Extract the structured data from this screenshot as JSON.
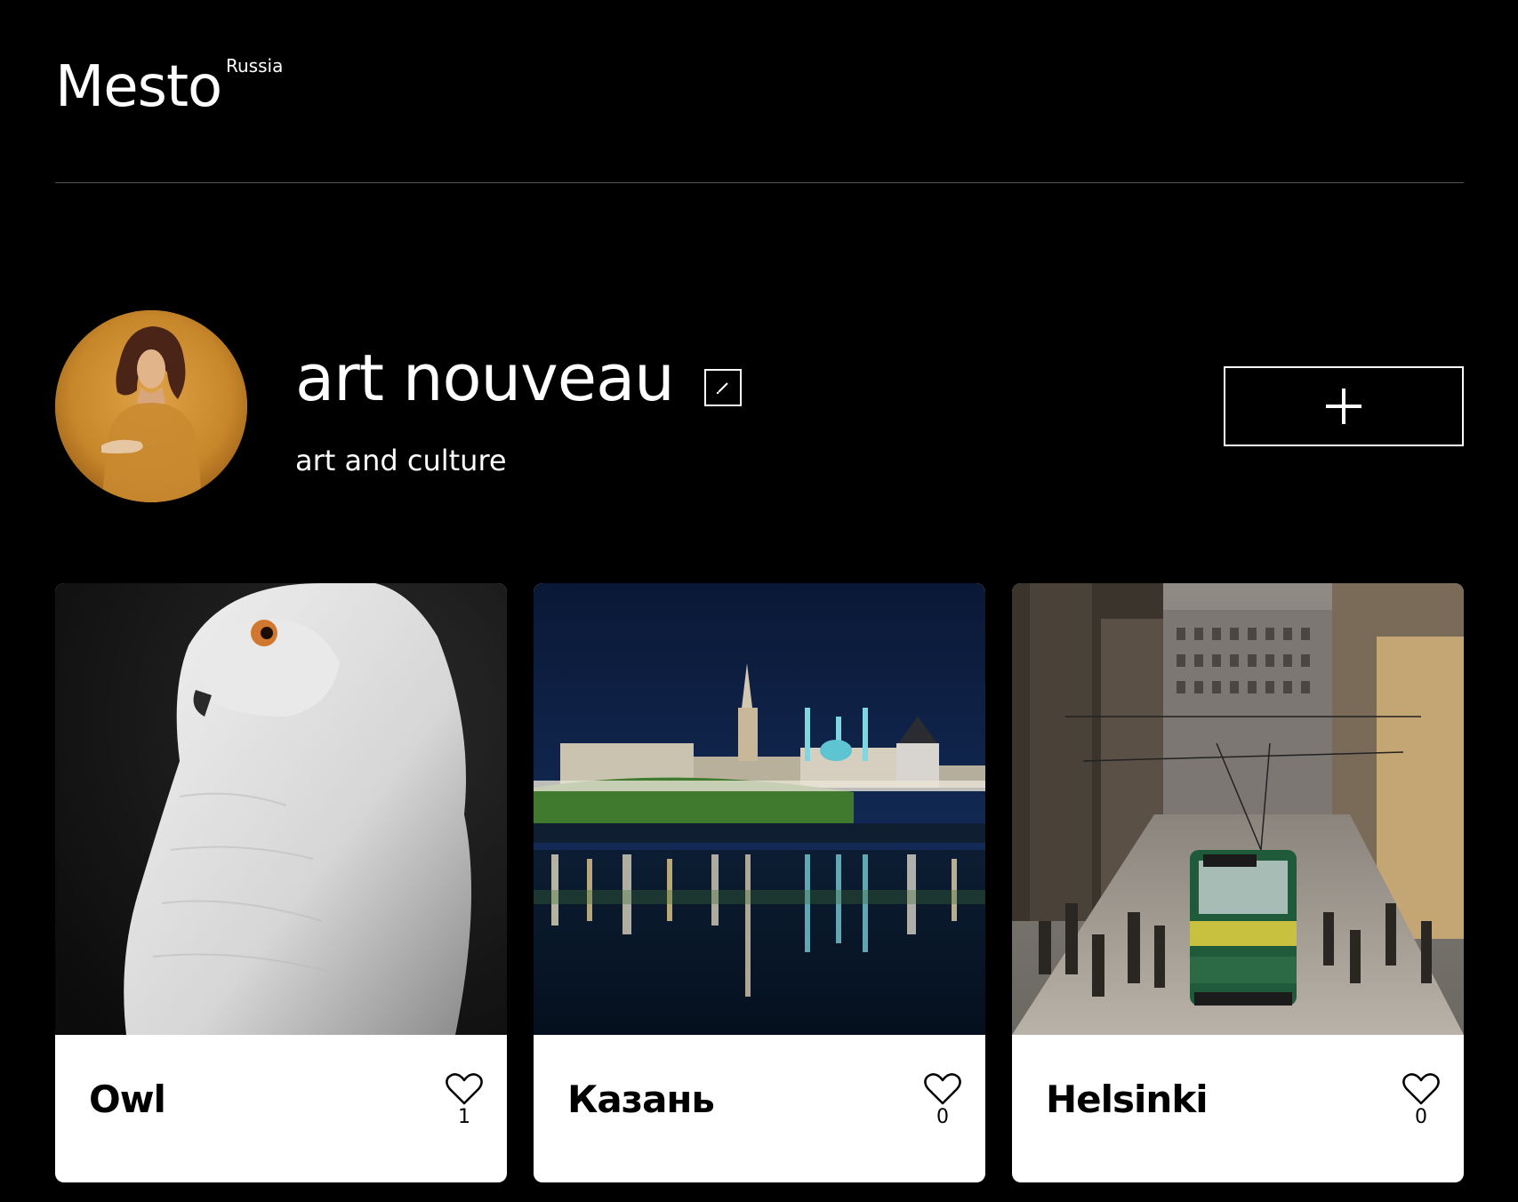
{
  "header": {
    "logo": "Mesto",
    "logo_superscript": "Russia"
  },
  "profile": {
    "name": "art nouveau",
    "about": "art and culture",
    "avatar_icon": "portrait-painting",
    "edit_icon": "pencil-icon",
    "add_icon": "plus-icon"
  },
  "cards": [
    {
      "title": "Owl",
      "likes": "1",
      "image": "snowy-owl-photo"
    },
    {
      "title": "Казань",
      "likes": "0",
      "image": "kazan-kremlin-night-photo"
    },
    {
      "title": "Helsinki",
      "likes": "0",
      "image": "helsinki-tram-street-photo"
    }
  ],
  "colors": {
    "background": "#000000",
    "text": "#ffffff",
    "card_footer": "#ffffff",
    "divider": "#545454"
  }
}
